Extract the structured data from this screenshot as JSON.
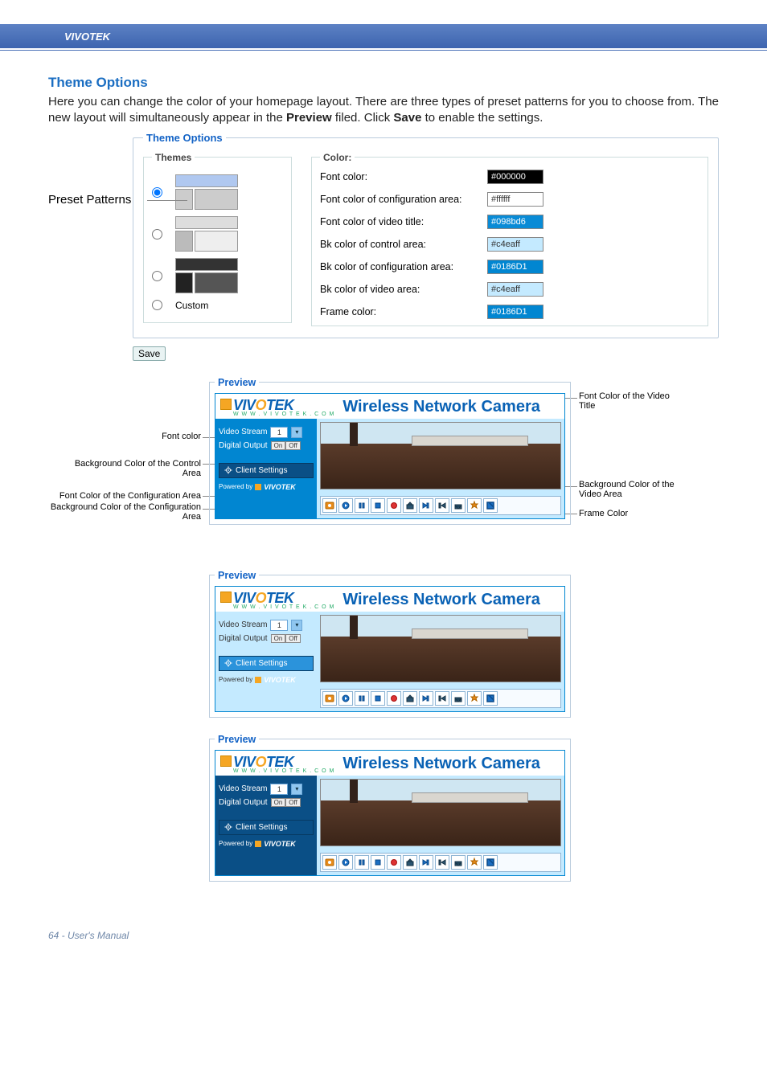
{
  "brand": "VIVOTEK",
  "section_title": "Theme Options",
  "body_parts": {
    "p1a": "Here you can change the color of your homepage layout. There are three types of preset patterns for you to choose from. The new layout will simultaneously appear in the ",
    "p1b": "Preview",
    "p1c": " filed. Click ",
    "p1d": "Save",
    "p1e": " to enable the settings."
  },
  "labels": {
    "preset_patterns": "Preset Patterns",
    "theme_options_legend": "Theme Options",
    "themes_legend": "Themes",
    "color_legend": "Color:",
    "custom": "Custom",
    "save": "Save",
    "preview": "Preview"
  },
  "color_rows": [
    {
      "label": "Font color:",
      "value": "#000000",
      "bg": "#000000",
      "fg": "#ffffff"
    },
    {
      "label": "Font color of configuration area:",
      "value": "#ffffff",
      "bg": "#ffffff",
      "fg": "#333333"
    },
    {
      "label": "Font color of video title:",
      "value": "#098bd6",
      "bg": "#098bd6",
      "fg": "#ffffff"
    },
    {
      "label": "Bk color of control area:",
      "value": "#c4eaff",
      "bg": "#c4eaff",
      "fg": "#333333"
    },
    {
      "label": "Bk color of configuration area:",
      "value": "#0186D1",
      "bg": "#0186D1",
      "fg": "#ffffff"
    },
    {
      "label": "Bk color of video area:",
      "value": "#c4eaff",
      "bg": "#c4eaff",
      "fg": "#333333"
    },
    {
      "label": "Frame color:",
      "value": "#0186D1",
      "bg": "#0186D1",
      "fg": "#ffffff"
    }
  ],
  "preview": {
    "logo_text_a": "VIV",
    "logo_text_o": "O",
    "logo_text_b": "TEK",
    "logo_sub": "W W W . V I V O T E K . C O M",
    "title": "Wireless Network Camera",
    "video_stream": "Video Stream",
    "stream_value": "1",
    "digital_output": "Digital Output",
    "on": "On",
    "off": "Off",
    "client_settings": "Client Settings",
    "powered_by": "Powered by"
  },
  "callouts": {
    "font_color": "Font color",
    "bg_control": "Background Color of the Control Area",
    "fc_conf": "Font Color of the Configuration Area",
    "bg_conf": "Background Color of the Configuration Area",
    "fc_video_title": "Font Color of the Video Title",
    "bg_video": "Background Color of the Video Area",
    "frame_color": "Frame Color"
  },
  "footer": "64 - User's Manual"
}
